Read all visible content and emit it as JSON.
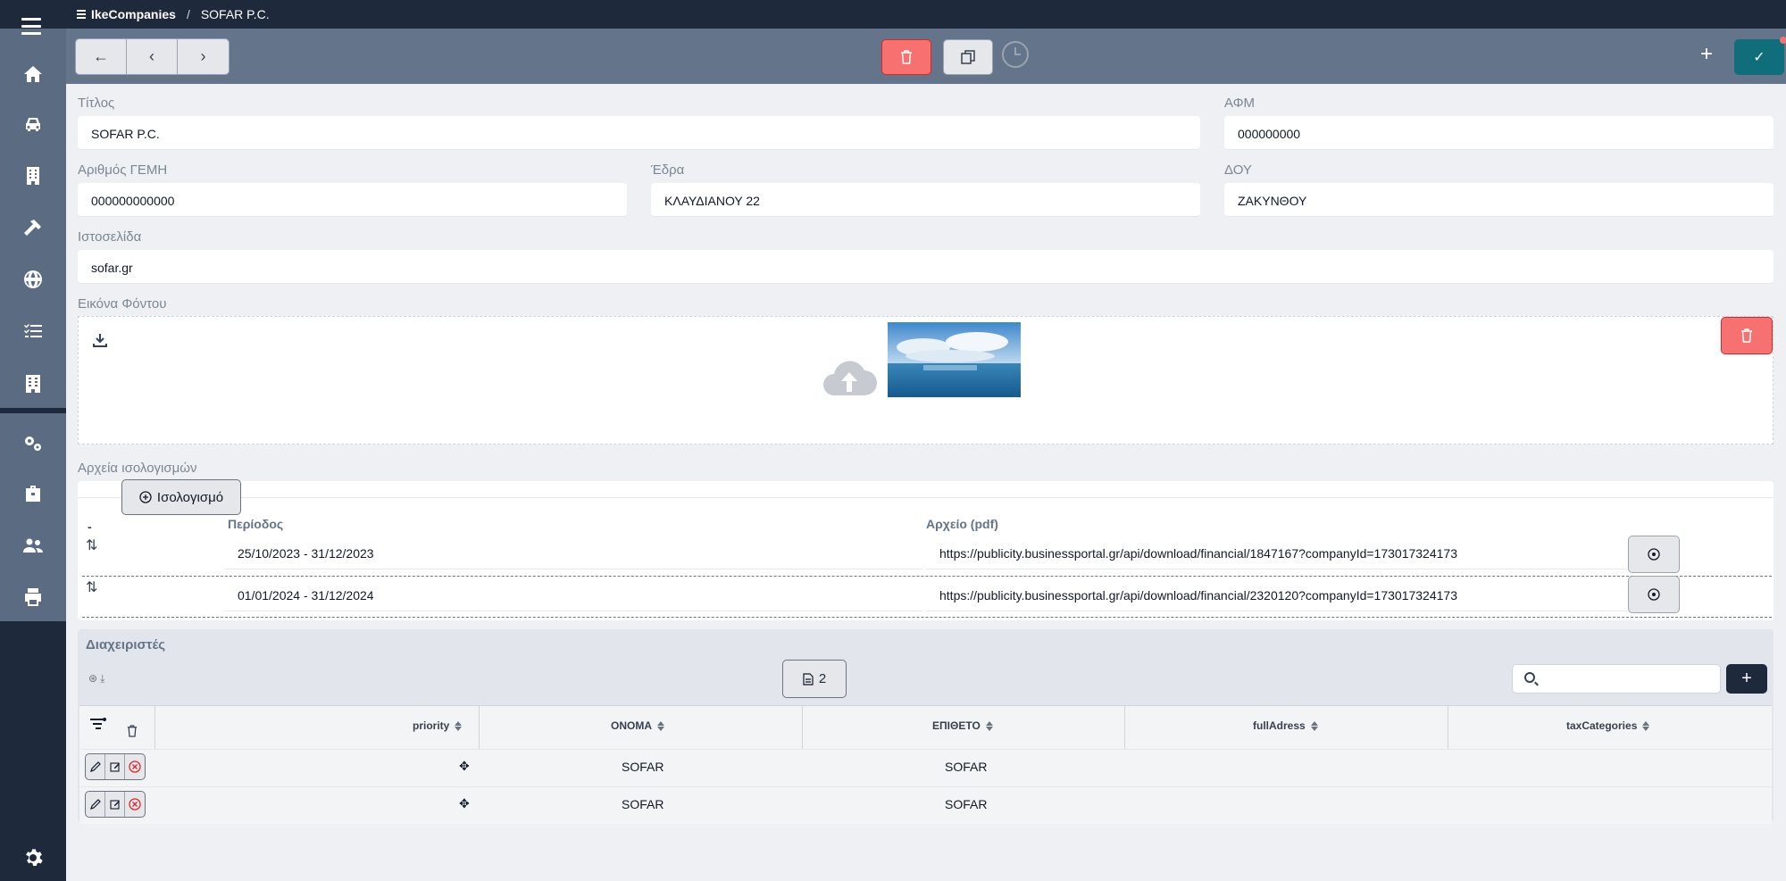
{
  "breadcrumb": {
    "app": "IkeCompanies",
    "separator": "/",
    "current": "SOFAR P.C."
  },
  "sidebar": {
    "items": [
      "home-icon",
      "car-icon",
      "building-icon",
      "hammer-icon",
      "globe-icon",
      "tasks-icon",
      "office-icon",
      "gears-icon",
      "briefcase-icon",
      "users-icon",
      "printer-icon"
    ],
    "settings": "gear-icon"
  },
  "toolbar": {
    "back": "←",
    "prev": "‹",
    "next": "›",
    "add": "+",
    "save": "✓"
  },
  "form": {
    "title": {
      "label": "Τίτλος",
      "value": "SOFAR P.C."
    },
    "afm": {
      "label": "ΑΦΜ",
      "value": "000000000"
    },
    "gemi": {
      "label": "Αριθμός ΓΕΜΗ",
      "value": "000000000000"
    },
    "edra": {
      "label": "Έδρα",
      "value": "ΚΛΑΥΔΙΑΝΟΥ 22"
    },
    "doy": {
      "label": "ΔΟΥ",
      "value": "ΖΑΚΥΝΘΟΥ"
    },
    "website": {
      "label": "Ιστοσελίδα",
      "value": "sofar.gr"
    },
    "background": {
      "label": "Εικόνα Φόντου"
    }
  },
  "balance": {
    "section_label": "Αρχεία ισολογισμών",
    "add_button": "Ισολογισμό",
    "dash": "-",
    "col_period": "Περίοδος",
    "col_file": "Αρχείο (pdf)",
    "rows": [
      {
        "period": "25/10/2023 - 31/12/2023",
        "url": "https://publicity.businessportal.gr/api/download/financial/1847167?companyId=173017324173"
      },
      {
        "period": "01/01/2024 - 31/12/2024",
        "url": "https://publicity.businessportal.gr/api/download/financial/2320120?companyId=173017324173"
      }
    ]
  },
  "managers": {
    "title": "Διαχειριστές",
    "page_count": "2",
    "columns": [
      "priority",
      "ΟΝΟΜΑ",
      "ΕΠΙΘΕΤΟ",
      "fullAdress",
      "taxCategories"
    ],
    "rows": [
      {
        "first": "SOFAR",
        "last": "SOFAR"
      },
      {
        "first": "SOFAR",
        "last": "SOFAR"
      }
    ]
  }
}
